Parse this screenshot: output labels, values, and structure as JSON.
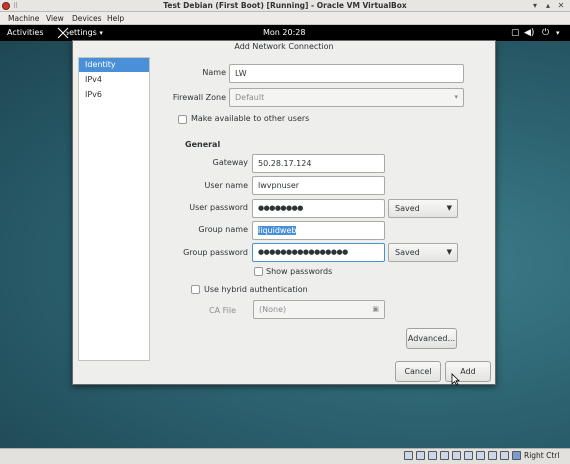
{
  "host": {
    "title": "Test Debian (First Boot) [Running] - Oracle VM VirtualBox",
    "menus": [
      "Machine",
      "View",
      "Devices",
      "Help"
    ],
    "host_key": "Right Ctrl"
  },
  "gnome": {
    "activities": "Activities",
    "app_menu": "Settings",
    "clock": "Mon 20:28"
  },
  "dialog": {
    "title": "Add Network Connection",
    "sidebar": [
      "Identity",
      "IPv4",
      "IPv6"
    ],
    "name": {
      "label": "Name",
      "value": "LW"
    },
    "firewall": {
      "label": "Firewall Zone",
      "value": "Default"
    },
    "available": "Make available to other users",
    "general_heading": "General",
    "gateway": {
      "label": "Gateway",
      "value": "50.28.17.124"
    },
    "username": {
      "label": "User name",
      "value": "lwvpnuser"
    },
    "user_password": {
      "label": "User password",
      "value": "●●●●●●●●",
      "mode": "Saved"
    },
    "group_name": {
      "label": "Group name",
      "value": "liquidweb"
    },
    "group_password": {
      "label": "Group password",
      "value": "●●●●●●●●●●●●●●●●",
      "mode": "Saved"
    },
    "show_passwords": "Show passwords",
    "hybrid": "Use hybrid authentication",
    "ca_file": {
      "label": "CA File",
      "value": "(None)"
    },
    "advanced": "Advanced...",
    "cancel": "Cancel",
    "add": "Add"
  }
}
